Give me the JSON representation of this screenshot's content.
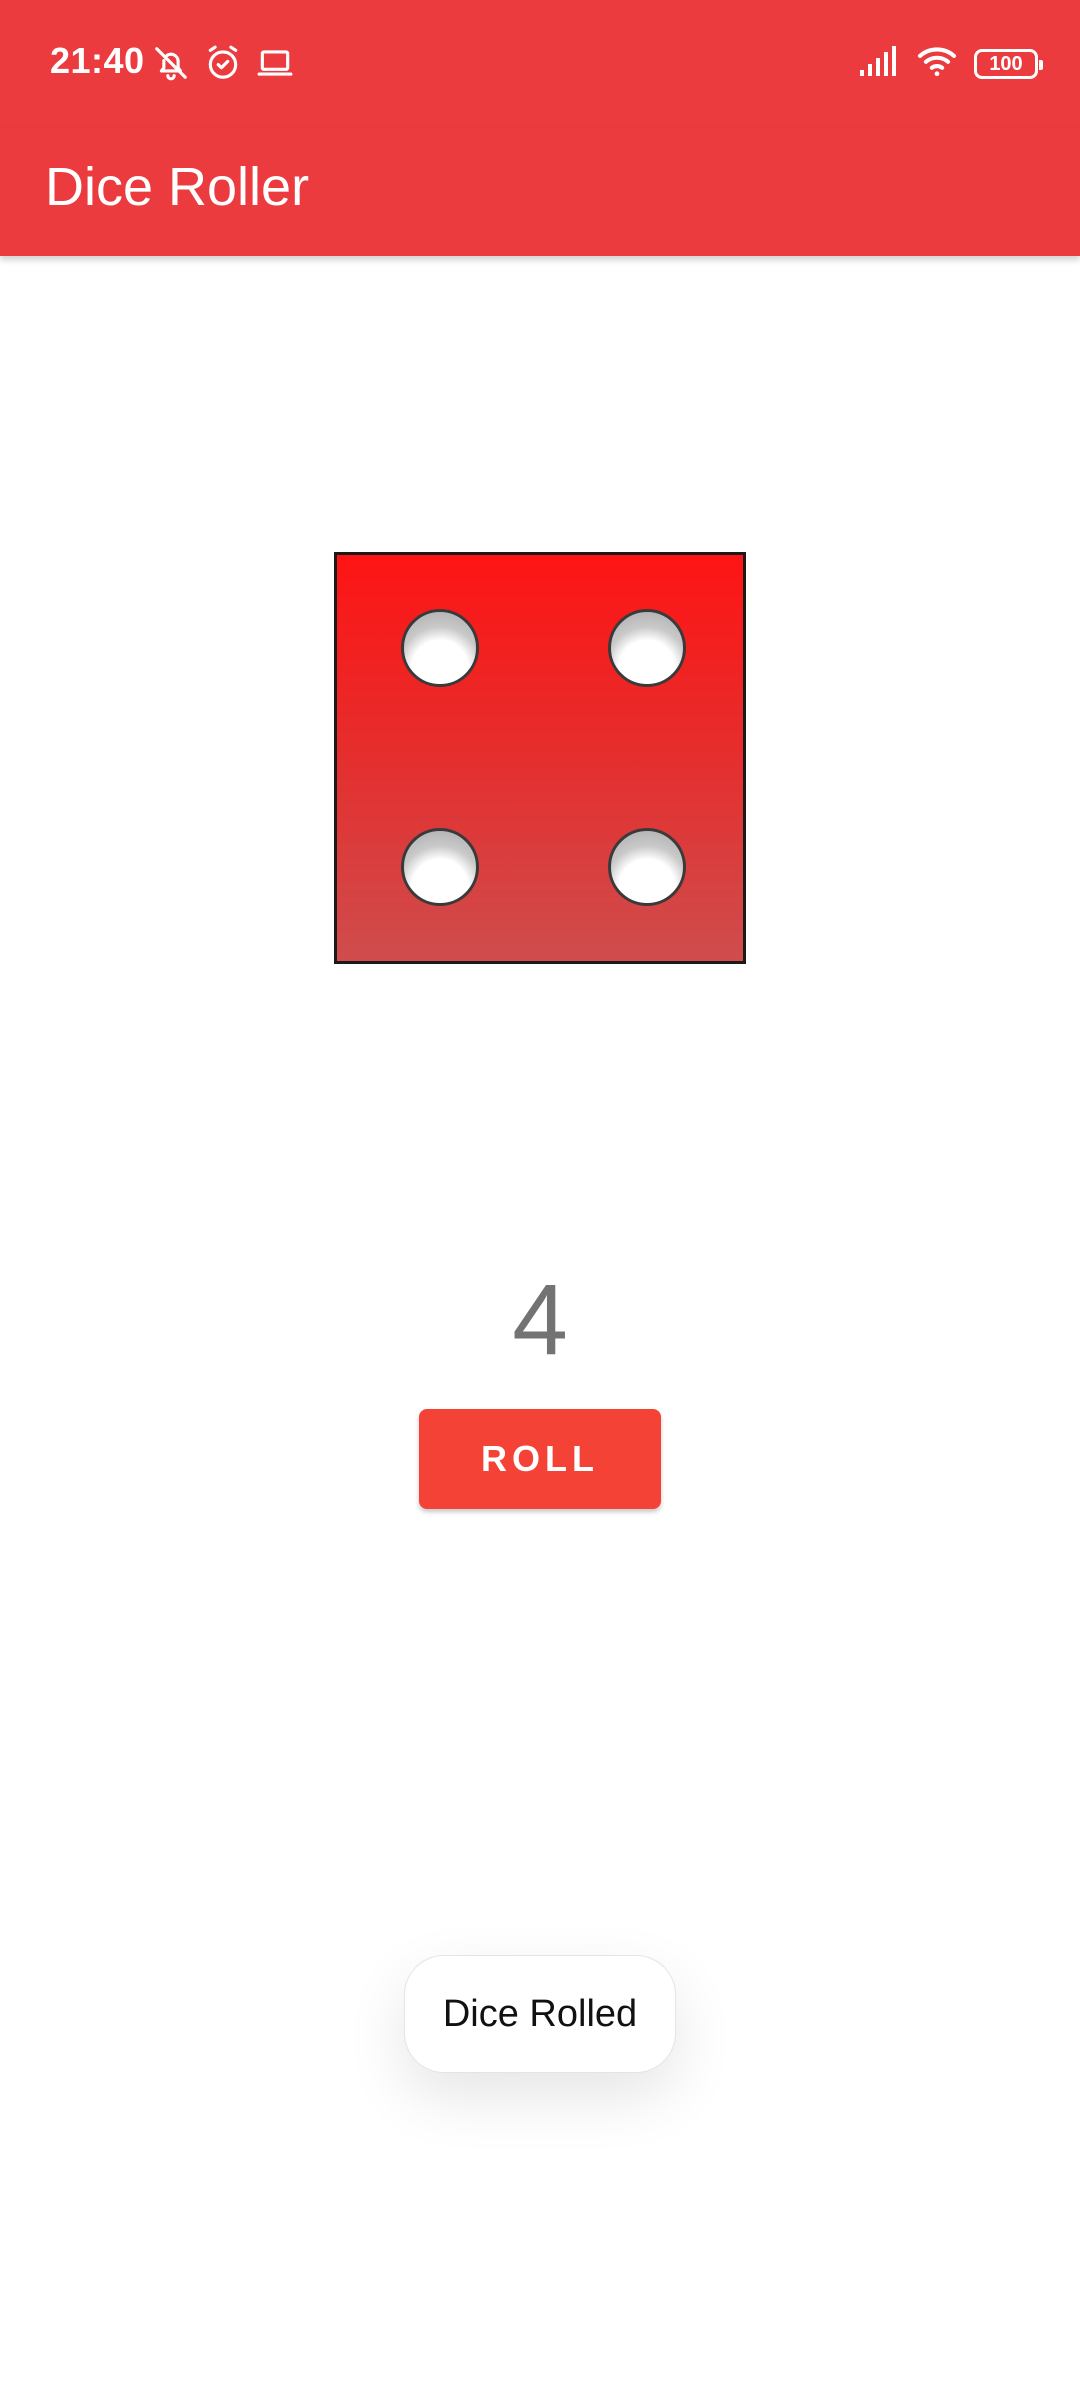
{
  "status_bar": {
    "time": "21:40",
    "left_icons": [
      "bell-off-icon",
      "alarm-icon",
      "laptop-icon"
    ],
    "right_icons": [
      "signal-icon",
      "wifi-icon",
      "battery-icon"
    ],
    "battery_level": "100"
  },
  "app_bar": {
    "title": "Dice Roller"
  },
  "dice": {
    "face_value": 4,
    "icon": "dice-four-icon"
  },
  "result": {
    "value": "4"
  },
  "roll_button": {
    "label": "ROLL"
  },
  "toast": {
    "message": "Dice Rolled"
  },
  "colors": {
    "primary": "#eb3b3f",
    "button": "#f44336",
    "result_text": "#737373"
  }
}
